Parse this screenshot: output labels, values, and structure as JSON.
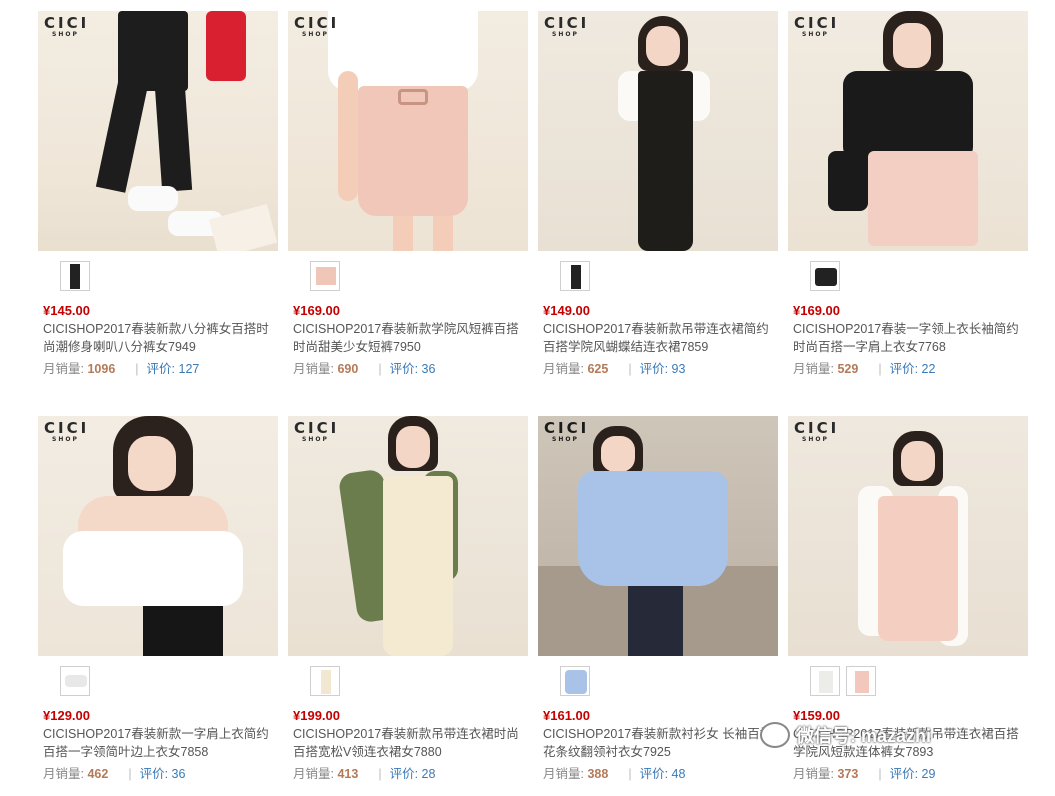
{
  "products": [
    {
      "price": "¥145.00",
      "title": "CICISHOP2017春装新款八分裤女百搭时尚潮修身喇叭八分裤女7949",
      "sales_label": "月销量:",
      "sales": "1096",
      "review_label": "评价:",
      "reviews": "127",
      "brand": "CICI",
      "shop": "SHOP"
    },
    {
      "price": "¥169.00",
      "title": "CICISHOP2017春装新款学院风短裤百搭时尚甜美少女短裤7950",
      "sales_label": "月销量:",
      "sales": "690",
      "review_label": "评价:",
      "reviews": "36",
      "brand": "CICI",
      "shop": "SHOP"
    },
    {
      "price": "¥149.00",
      "title": "CICISHOP2017春装新款吊带连衣裙简约百搭学院风蝴蝶结连衣裙7859",
      "sales_label": "月销量:",
      "sales": "625",
      "review_label": "评价:",
      "reviews": "93",
      "brand": "CICI",
      "shop": "SHOP"
    },
    {
      "price": "¥169.00",
      "title": "CICISHOP2017春装一字领上衣长袖简约时尚百搭一字肩上衣女7768",
      "sales_label": "月销量:",
      "sales": "529",
      "review_label": "评价:",
      "reviews": "22",
      "brand": "CICI",
      "shop": "SHOP"
    },
    {
      "price": "¥129.00",
      "title": "CICISHOP2017春装新款一字肩上衣简约百搭一字领简叶边上衣女7858",
      "sales_label": "月销量:",
      "sales": "462",
      "review_label": "评价:",
      "reviews": "36",
      "brand": "CICI",
      "shop": "SHOP"
    },
    {
      "price": "¥199.00",
      "title": "CICISHOP2017春装新款吊带连衣裙时尚百搭宽松V领连衣裙女7880",
      "sales_label": "月销量:",
      "sales": "413",
      "review_label": "评价:",
      "reviews": "28",
      "brand": "CICI",
      "shop": "SHOP"
    },
    {
      "price": "¥161.00",
      "title": "CICISHOP2017春装新款衬衫女 长袖百搭花条纹翻领衬衣女7925",
      "sales_label": "月销量:",
      "sales": "388",
      "review_label": "评价:",
      "reviews": "48",
      "brand": "CICI",
      "shop": "SHOP"
    },
    {
      "price": "¥159.00",
      "title": "CICISHOP2017春装新款吊带连衣裙百搭学院风短款连体裤女7893",
      "sales_label": "月销量:",
      "sales": "373",
      "review_label": "评价:",
      "reviews": "29",
      "brand": "CICI",
      "shop": "SHOP"
    }
  ],
  "watermark": "微信号: mazazhi"
}
